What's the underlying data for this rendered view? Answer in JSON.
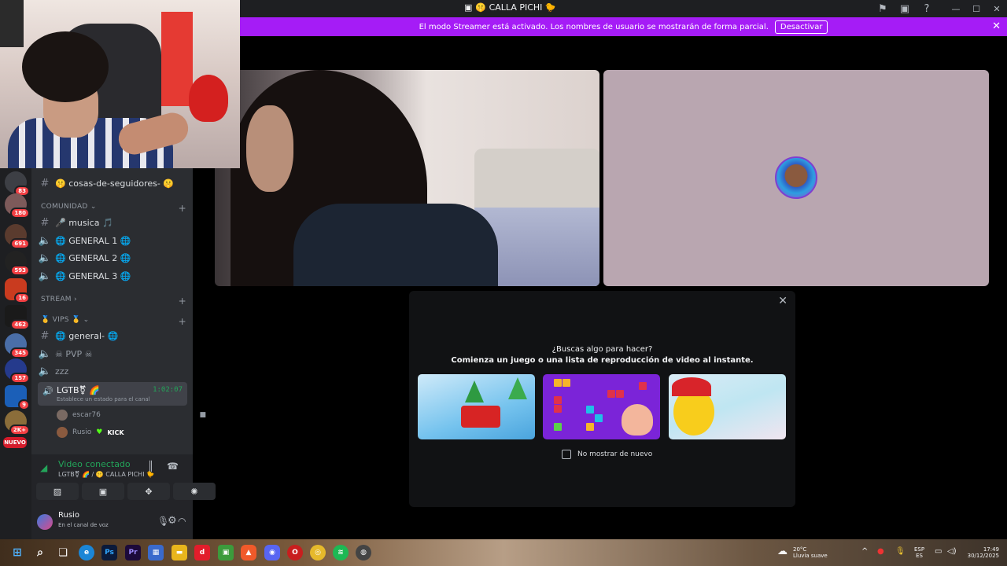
{
  "window": {
    "title": "🤫 CALLA PICHI 🐤"
  },
  "banner": {
    "message": "El modo Streamer está activado. Los nombres de usuario se mostrarán de forma parcial.",
    "button": "Desactivar"
  },
  "servers": [
    {
      "badge": "83"
    },
    {
      "badge": "180"
    },
    {
      "badge": "691"
    },
    {
      "badge": "593"
    },
    {
      "badge": "16"
    },
    {
      "badge": "462"
    },
    {
      "badge": "345"
    },
    {
      "badge": "157"
    },
    {
      "badge": "9"
    },
    {
      "badge": "2K+"
    },
    {
      "badge": "NUEVO"
    }
  ],
  "sidebar": {
    "top_channel": "🤫 cosas-de-seguidores- 🤫",
    "category_comunidad": "COMUNIDAD",
    "channels_comunidad": [
      "🎤 musica 🎵",
      "🌐 GENERAL 1 🌐",
      "🌐 GENERAL 2 🌐",
      "🌐 GENERAL 3 🌐"
    ],
    "category_stream": "STREAM",
    "category_vips": "🥇 VIPS 🥇",
    "channels_vips": [
      "🌐 general- 🌐",
      "☠ PVP ☠",
      "zzz"
    ],
    "active_voice": {
      "name": "LGTB⚧ 🌈",
      "timer": "1:02:07",
      "status": "Establece un estado para el canal"
    },
    "members": [
      {
        "name": "escar76"
      },
      {
        "name": "Rusio",
        "tag": "KICK"
      }
    ]
  },
  "voice_panel": {
    "status": "Video conectado",
    "location": "LGTB⚧ 🌈 / 🤫 CALLA PICHI 🐤"
  },
  "user": {
    "name": "Rusio",
    "status": "En el canal de voz"
  },
  "activity_modal": {
    "question": "¿Buscas algo para hacer?",
    "subtitle": "Comienza un juego o una lista de reproducción de video al instante.",
    "checkbox_label": "No mostrar de nuevo"
  },
  "taskbar": {
    "weather_temp": "20°C",
    "weather_desc": "Lluvia suave",
    "lang_1": "ESP",
    "lang_2": "ES",
    "time": "17:49",
    "date": "30/12/2025"
  },
  "colors": {
    "banner": "#a51cf6",
    "connected": "#23a55a",
    "badge": "#f23f43"
  }
}
